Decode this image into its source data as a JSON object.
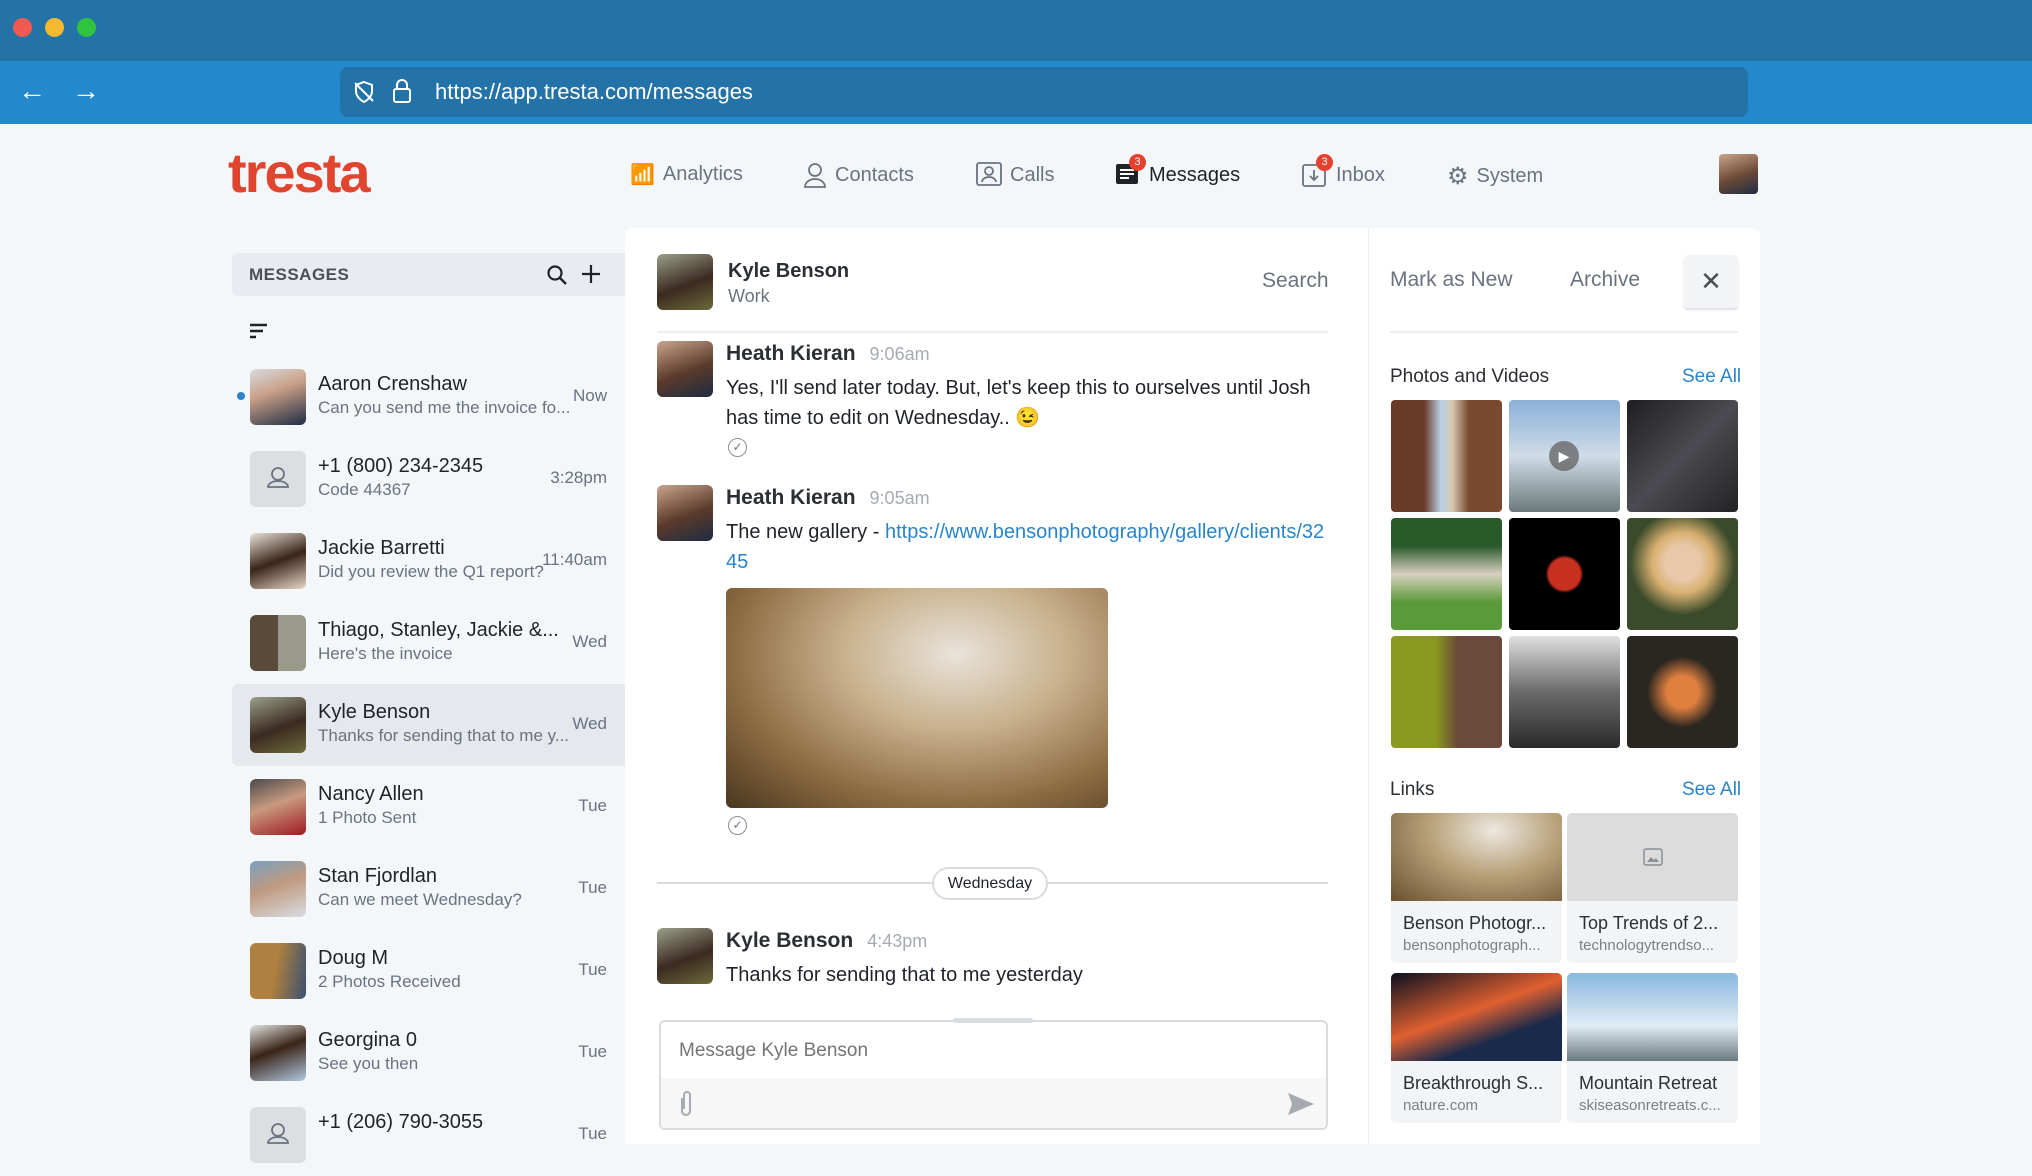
{
  "browser": {
    "url": "https://app.tresta.com/messages"
  },
  "app": {
    "logo": "tresta",
    "brand_color": "#e0452f",
    "accent_color": "#2a84c9"
  },
  "nav": [
    {
      "label": "Analytics",
      "icon": "analytics-icon"
    },
    {
      "label": "Contacts",
      "icon": "contacts-icon"
    },
    {
      "label": "Calls",
      "icon": "calls-icon"
    },
    {
      "label": "Messages",
      "icon": "messages-icon",
      "badge": "3",
      "active": true
    },
    {
      "label": "Inbox",
      "icon": "inbox-icon",
      "badge": "3"
    },
    {
      "label": "System",
      "icon": "gear-icon"
    }
  ],
  "sidebar": {
    "title": "MESSAGES",
    "items": [
      {
        "name": "Aaron Crenshaw",
        "preview": "Can you send me the invoice fo...",
        "time": "Now",
        "unread": true
      },
      {
        "name": "+1 (800) 234-2345",
        "preview": "Code 44367",
        "time": "3:28pm"
      },
      {
        "name": "Jackie Barretti",
        "preview": "Did you review the Q1 report?",
        "time": "11:40am"
      },
      {
        "name": "Thiago, Stanley, Jackie &...",
        "preview": "Here's the invoice",
        "time": "Wed"
      },
      {
        "name": "Kyle Benson",
        "preview": "Thanks for sending that to me y...",
        "time": "Wed",
        "selected": true
      },
      {
        "name": "Nancy Allen",
        "preview": "1 Photo Sent",
        "time": "Tue"
      },
      {
        "name": "Stan Fjordlan",
        "preview": "Can we meet Wednesday?",
        "time": "Tue"
      },
      {
        "name": "Doug M",
        "preview": "2 Photos Received",
        "time": "Tue"
      },
      {
        "name": "Georgina 0",
        "preview": "See you then",
        "time": "Tue"
      },
      {
        "name": "+1 (206) 790-3055",
        "preview": "",
        "time": "Tue"
      }
    ]
  },
  "chat": {
    "contact": "Kyle Benson",
    "label": "Work",
    "search": "Search",
    "messages": [
      {
        "sender": "Heath Kieran",
        "time": "9:06am",
        "text": "Yes, I'll send later today. But, let's keep this to ourselves until Josh has time to edit on Wednesday.. 😉"
      },
      {
        "sender": "Heath Kieran",
        "time": "9:05am",
        "text": "The new gallery - ",
        "link": "https://www.bensonphotography/gallery/clients/3245"
      },
      {
        "sender": "Kyle Benson",
        "time": "4:43pm",
        "text": "Thanks for sending that to me yesterday"
      }
    ],
    "divider": "Wednesday",
    "composer_placeholder": "Message Kyle Benson"
  },
  "details": {
    "mark_new": "Mark as New",
    "archive": "Archive",
    "photos_title": "Photos and Videos",
    "photos_see_all": "See All",
    "links_title": "Links",
    "links_see_all": "See All",
    "links": [
      {
        "title": "Benson Photogr...",
        "domain": "bensonphotograph..."
      },
      {
        "title": "Top Trends of 2...",
        "domain": "technologytrendso..."
      },
      {
        "title": "Breakthrough S...",
        "domain": "nature.com"
      },
      {
        "title": "Mountain Retreat",
        "domain": "skiseasonretreats.c..."
      }
    ]
  }
}
